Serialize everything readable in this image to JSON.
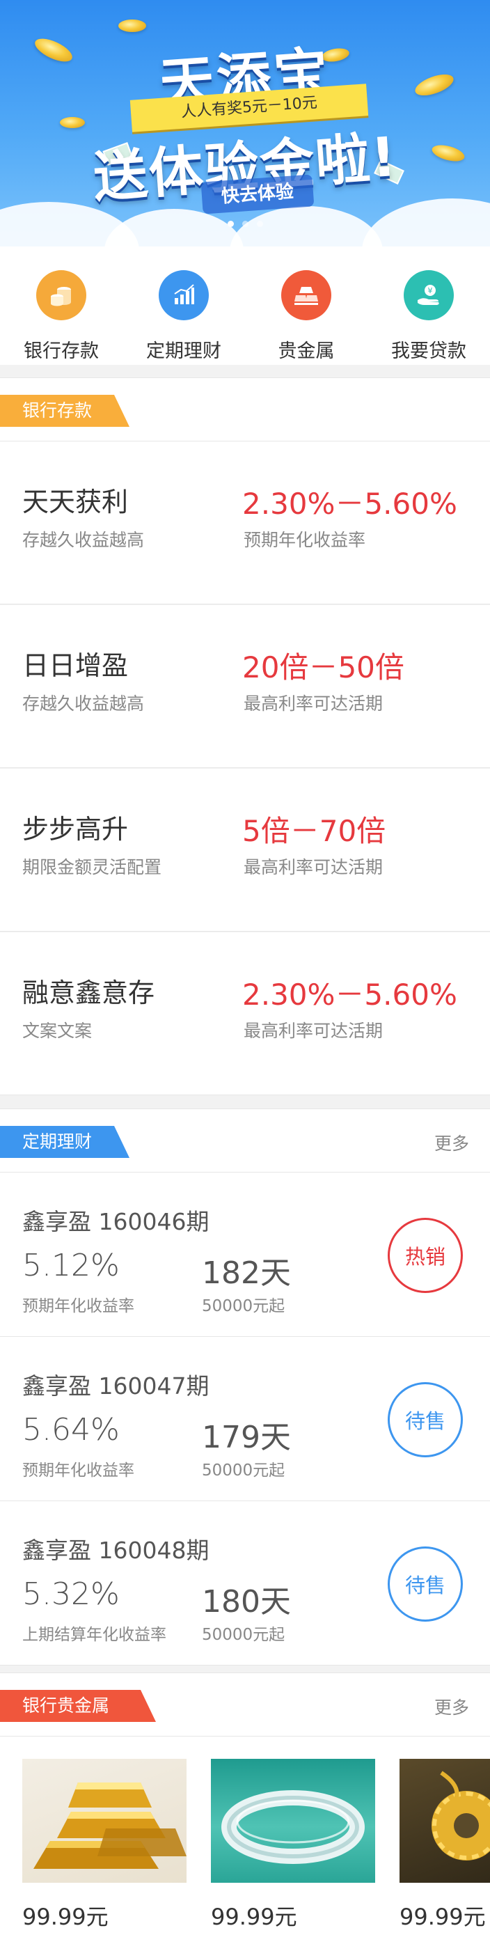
{
  "banner": {
    "title": "天添宝",
    "ribbon": "人人有奖5元－10元",
    "subtitle": "送体验金啦!",
    "cta": "快去体验",
    "slide_count": 3,
    "active_slide": 1
  },
  "quick_menu": [
    {
      "label": "银行存款",
      "icon": "coins-icon",
      "color": "#f5a93a"
    },
    {
      "label": "定期理财",
      "icon": "bar-chart-icon",
      "color": "#3d96ef"
    },
    {
      "label": "贵金属",
      "icon": "gold-bar-icon",
      "color": "#f05a3a"
    },
    {
      "label": "我要贷款",
      "icon": "hand-money-icon",
      "color": "#2cbfb2"
    }
  ],
  "deposit_section": {
    "title": "银行存款",
    "color": "#f9ae3b",
    "items": [
      {
        "name": "天天获利",
        "desc": "存越久收益越高",
        "rate": "2.30%－5.60%",
        "note": "预期年化收益率"
      },
      {
        "name": "日日增盈",
        "desc": "存越久收益越高",
        "rate": "20倍－50倍",
        "note": "最高利率可达活期"
      },
      {
        "name": "步步高升",
        "desc": "期限金额灵活配置",
        "rate": "5倍－70倍",
        "note": "最高利率可达活期"
      },
      {
        "name": "融意鑫意存",
        "desc": "文案文案",
        "rate": "2.30%－5.60%",
        "note": "最高利率可达活期"
      }
    ]
  },
  "finance_section": {
    "title": "定期理财",
    "more": "更多",
    "color": "#3d96ef",
    "items": [
      {
        "title": "鑫享盈 160046期",
        "rate": "5.12%",
        "rate_note": "预期年化收益率",
        "days": "182天",
        "min": "50000元起",
        "badge": "热销",
        "badge_type": "hot"
      },
      {
        "title": "鑫享盈 160047期",
        "rate": "5.64%",
        "rate_note": "预期年化收益率",
        "days": "179天",
        "min": "50000元起",
        "badge": "待售",
        "badge_type": "wait"
      },
      {
        "title": "鑫享盈 160048期",
        "rate": "5.32%",
        "rate_note": "上期结算年化收益率",
        "days": "180天",
        "min": "50000元起",
        "badge": "待售",
        "badge_type": "wait"
      }
    ]
  },
  "metal_section": {
    "title": "银行贵金属",
    "more": "更多",
    "color": "#f0563c",
    "items": [
      {
        "price": "99.99元",
        "image": "gold-bars"
      },
      {
        "price": "99.99元",
        "image": "silver-bangle"
      },
      {
        "price": "99.99元",
        "image": "gold-pendant"
      }
    ]
  }
}
